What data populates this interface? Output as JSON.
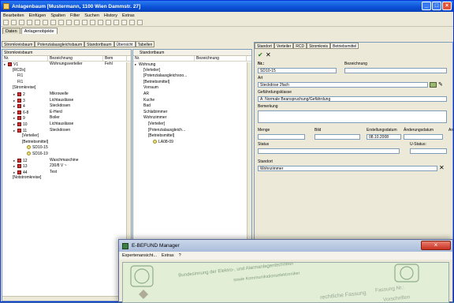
{
  "app": {
    "title": "Anlagenbaum [Mustermann, 1100 Wien Dammstr. 27]",
    "menu": [
      "Bearbeiten",
      "Einfügen",
      "Spalten",
      "Filter",
      "Suchen",
      "History",
      "Extras"
    ],
    "tabs": [
      "Daten",
      "Anlagenobjekte"
    ]
  },
  "subtabs": [
    "Stromkreisbaum",
    "Potenzialausgleichsbaum",
    "Standortbaum",
    "Übersicht",
    "Tabellen"
  ],
  "left_panel": {
    "header": "Stromkreisbaum",
    "columns": [
      "Nr.",
      "Bezeichnung",
      "Bem"
    ],
    "rows": [
      {
        "nr": "V1",
        "bez": "Wohnungsverteiler",
        "bem": "Fehl",
        "indent": 0,
        "icon": "red"
      },
      {
        "nr": "[RCDs]",
        "bez": "",
        "indent": 1,
        "icon": "none"
      },
      {
        "nr": "FI1",
        "bez": "",
        "indent": 2,
        "icon": "none"
      },
      {
        "nr": "FI1",
        "bez": "",
        "indent": 2,
        "icon": "none"
      },
      {
        "nr": "[Stromkreise]",
        "bez": "",
        "indent": 1,
        "icon": "none"
      },
      {
        "nr": "2",
        "bez": "Mikrowelle",
        "indent": 2,
        "icon": "red"
      },
      {
        "nr": "3",
        "bez": "Lichtauslässe",
        "indent": 2,
        "icon": "red"
      },
      {
        "nr": "4",
        "bez": "Steckdosen",
        "indent": 2,
        "icon": "red"
      },
      {
        "nr": "6-8",
        "bez": "E-Herd",
        "indent": 2,
        "icon": "red"
      },
      {
        "nr": "9",
        "bez": "Boiler",
        "indent": 2,
        "icon": "red"
      },
      {
        "nr": "10",
        "bez": "Lichtauslässe",
        "indent": 2,
        "icon": "red"
      },
      {
        "nr": "11",
        "bez": "Steckdosen",
        "indent": 2,
        "icon": "red"
      },
      {
        "nr": "[Verteiler]",
        "bez": "",
        "indent": 3,
        "icon": "none"
      },
      {
        "nr": "[Betriebsmittel]",
        "bez": "",
        "indent": 3,
        "icon": "none"
      },
      {
        "nr": "SD10-15",
        "bez": "",
        "indent": 4,
        "icon": "bulb"
      },
      {
        "nr": "SD16-19",
        "bez": "",
        "indent": 4,
        "icon": "bulb"
      },
      {
        "nr": "12",
        "bez": "Waschmaschine",
        "indent": 2,
        "icon": "red"
      },
      {
        "nr": "13",
        "bez": "230/8 V ~",
        "indent": 2,
        "icon": "red"
      },
      {
        "nr": "44",
        "bez": "Test",
        "indent": 2,
        "icon": "red"
      },
      {
        "nr": "[Notstromkreise]",
        "bez": "",
        "indent": 1,
        "icon": "none"
      }
    ]
  },
  "mid_panel": {
    "header": "Standortbaum",
    "columns": [
      "Nr.",
      "Bezeichnung"
    ],
    "rows": [
      {
        "nr": "Wohnung",
        "indent": 0,
        "icon": "none"
      },
      {
        "nr": "[Verteiler]",
        "indent": 1,
        "icon": "none"
      },
      {
        "nr": "[Potenzialausgleichsoo...",
        "indent": 1,
        "icon": "none"
      },
      {
        "nr": "[Betriebsmittel]",
        "indent": 1,
        "icon": "none"
      },
      {
        "nr": "Vorraum",
        "indent": 1,
        "icon": "none"
      },
      {
        "nr": "AR",
        "indent": 1,
        "icon": "none"
      },
      {
        "nr": "Kuche",
        "indent": 1,
        "icon": "none"
      },
      {
        "nr": "Bad",
        "indent": 1,
        "icon": "none"
      },
      {
        "nr": "Schlafzimmer",
        "indent": 1,
        "icon": "none"
      },
      {
        "nr": "Wohnzimmer",
        "indent": 1,
        "icon": "none"
      },
      {
        "nr": "[Verteiler]",
        "indent": 2,
        "icon": "none"
      },
      {
        "nr": "[Potenzialausgleich...",
        "indent": 2,
        "icon": "none"
      },
      {
        "nr": "[Betriebsmittel]",
        "indent": 2,
        "icon": "none"
      },
      {
        "nr": "LA08-09",
        "indent": 3,
        "icon": "bulb"
      }
    ]
  },
  "right_panel": {
    "tabs": [
      "Standort",
      "Verteiler",
      "RCD",
      "Stromkreis",
      "Betriebsmittel"
    ],
    "nr_label": "Nr.:",
    "bez_label": "Bezeichnung",
    "nr_value": "SD10-15",
    "art_label": "Art",
    "art_value": "Steckdose 2fach",
    "gef_label": "Gefährdungsklasse",
    "gef_value": "A: Normale Beanspruchung/Gefährdung",
    "bem_label": "Bemerkung",
    "menge_label": "Menge",
    "bild_label": "Bild",
    "erst_label": "Erstellungsdatum",
    "aend_label": "Änderungsdatum",
    "an_label": "An",
    "erst_value": "08.10.2008",
    "status_label": "Status",
    "ustatus_label": "U-Status:",
    "standort_label": "Standort",
    "standort_value": "Wohnzimmer"
  },
  "ebefund": {
    "title": "E-BEFUND Manager",
    "menu": [
      "Expertenansicht...",
      "Extras",
      "?"
    ],
    "doc_line1": "Bundesinnung der Elektro-, und Alarmanlagentechniker",
    "doc_line2": "sowie Kommunikationselektroniker",
    "doc_line3": "Fassung Nr.:",
    "doc_line4": "rechtliche Fassung",
    "doc_line5": "Vorschriften"
  }
}
